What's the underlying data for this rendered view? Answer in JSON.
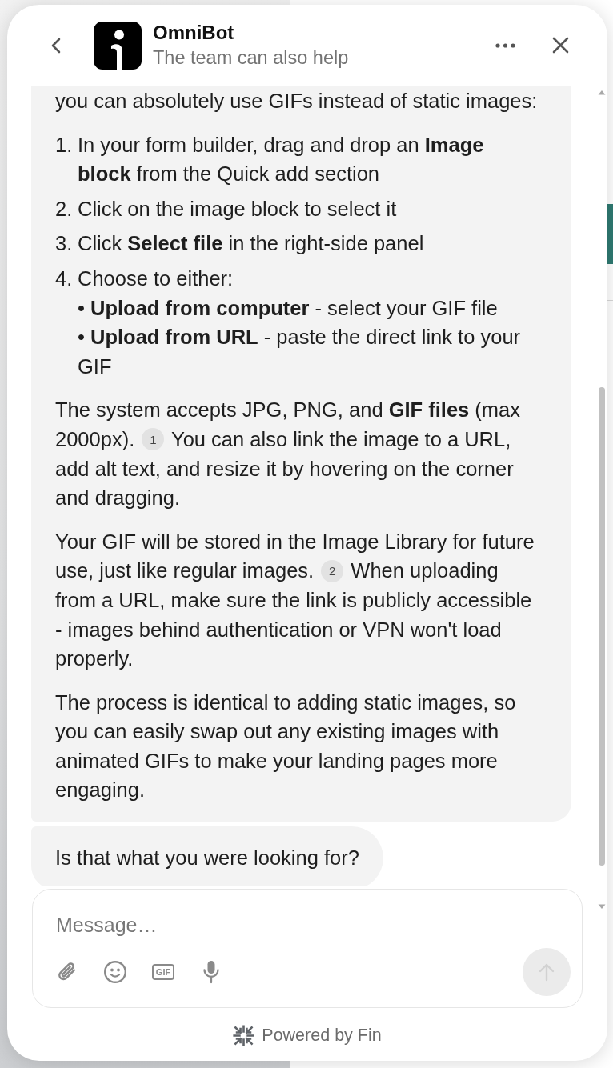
{
  "header": {
    "title": "OmniBot",
    "subtitle": "The team can also help"
  },
  "messages": [
    {
      "kind": "rich",
      "blocks": [
        {
          "kind": "paragraph",
          "segments": [
            {
              "kind": "text",
              "text": "you can absolutely use GIFs instead of static images:"
            }
          ]
        },
        {
          "kind": "ordered_list",
          "items": [
            {
              "number": "1.",
              "text": "In your form builder, drag and drop an **Image block** from the Quick add section"
            },
            {
              "number": "2.",
              "text": "Click on the image block to select it"
            },
            {
              "number": "3.",
              "text": "Click **Select file** in the right-side panel"
            },
            {
              "number": "4.",
              "text": "Choose to either:",
              "children": [
                {
                  "text": "• **Upload from computer** - select your GIF file"
                },
                {
                  "text": "• **Upload from URL** - paste the direct link to your GIF"
                }
              ]
            }
          ]
        },
        {
          "kind": "paragraph",
          "segments": [
            {
              "kind": "text",
              "text": "The system accepts JPG, PNG, and **GIF files** (max 2000px)."
            },
            {
              "kind": "citation",
              "label": "1"
            },
            {
              "kind": "text",
              "text": "You can also link the image to a URL, add alt text, and resize it by hovering on the corner and dragging."
            }
          ]
        },
        {
          "kind": "paragraph",
          "segments": [
            {
              "kind": "text",
              "text": "Your GIF will be stored in the Image Library for future use, just like regular images."
            },
            {
              "kind": "citation",
              "label": "2"
            },
            {
              "kind": "text",
              "text": "When uploading from a URL, make sure the link is publicly accessible - images behind authentication or VPN won't load properly."
            }
          ]
        },
        {
          "kind": "paragraph",
          "segments": [
            {
              "kind": "text",
              "text": "The process is identical to adding static images, so you can easily swap out any existing images with animated GIFs to make your landing pages more engaging."
            }
          ]
        }
      ]
    },
    {
      "kind": "plain",
      "text": "Is that what you were looking for?"
    }
  ],
  "composer": {
    "placeholder": "Message…",
    "gif_label": "GIF",
    "send_button": {
      "disabled": true
    }
  },
  "footer": {
    "text": "Powered by Fin"
  }
}
